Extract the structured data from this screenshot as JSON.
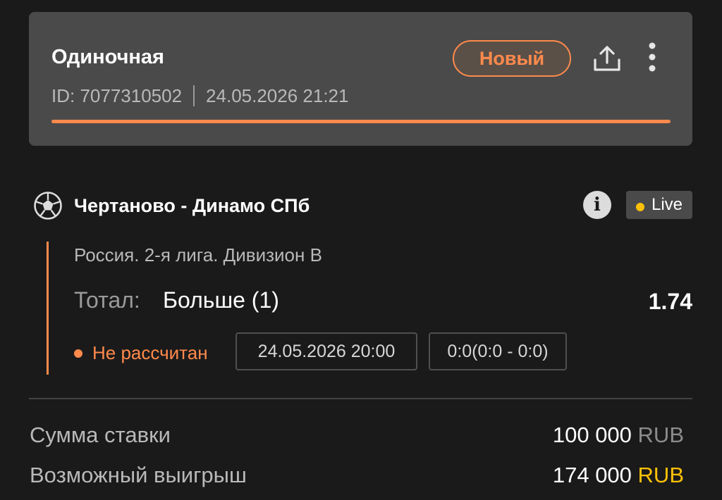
{
  "bet": {
    "type": "Одиночная",
    "id_text": "ID: 7077310502",
    "datetime": "24.05.2026 21:21",
    "status": "Новый",
    "progress_fraction": 1.0
  },
  "event": {
    "name": "Чертаново - Динамо СПб",
    "live_label": "Live",
    "info_glyph": "i",
    "sport_icon": "soccer-ball-icon",
    "league": "Россия. 2-я лига. Дивизион B",
    "market_label": "Тотал:",
    "market_value": "Больше (1)",
    "odds": "1.74",
    "settlement_status": "Не рассчитан",
    "start_datetime": "24.05.2026 20:00",
    "score": "0:0(0:0 - 0:0)"
  },
  "summary": {
    "stake_label": "Сумма ставки",
    "stake_amount": "100 000",
    "stake_currency": "RUB",
    "win_label": "Возможный выигрыш",
    "win_amount": "174 000",
    "win_currency": "RUB"
  },
  "colors": {
    "background": "#1a1a1a",
    "card": "#4a4a4a",
    "accent_orange": "#ff8a4c",
    "live_dot": "#ffc107",
    "win_currency": "#ffc107"
  }
}
